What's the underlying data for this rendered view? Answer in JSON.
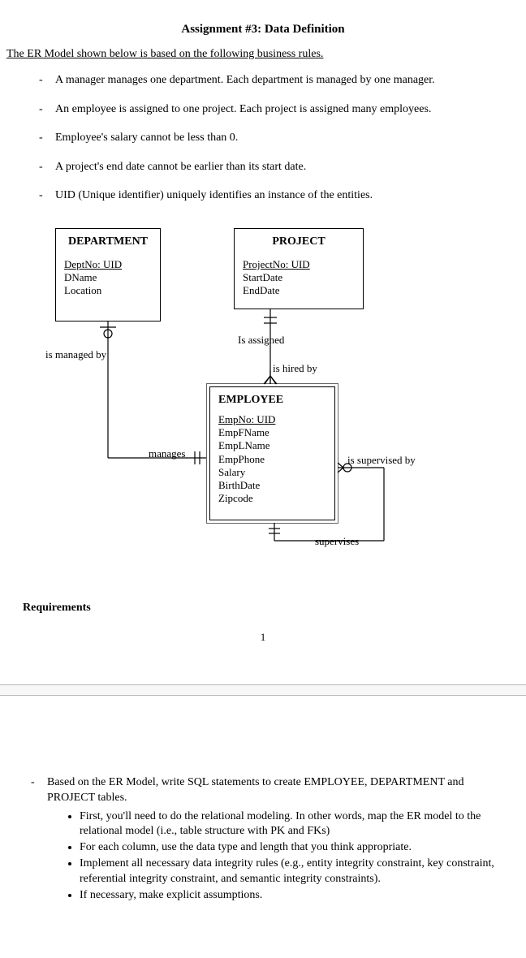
{
  "title": "Assignment #3: Data Definition",
  "intro": "The ER Model shown below is based on the following business rules.",
  "rules": [
    "A manager manages one department. Each department is managed by one manager.",
    "An employee is assigned to one project. Each project is assigned many employees.",
    "Employee's salary cannot be less than 0.",
    "A project's end date cannot be earlier than its start date.",
    "UID (Unique identifier) uniquely identifies an instance of the entities."
  ],
  "diagram": {
    "entities": {
      "department": {
        "name": "DEPARTMENT",
        "uid": "DeptNo: UID",
        "attrs": [
          "DName",
          "Location"
        ]
      },
      "project": {
        "name": "PROJECT",
        "uid": "ProjectNo: UID",
        "attrs": [
          "StartDate",
          "EndDate"
        ]
      },
      "employee": {
        "name": "EMPLOYEE",
        "uid": "EmpNo: UID",
        "attrs": [
          "EmpFName",
          "EmpLName",
          "EmpPhone",
          "Salary",
          "BirthDate",
          "Zipcode"
        ]
      }
    },
    "rels": {
      "managed_by": "is managed by",
      "manages": "manages",
      "is_assigned": "Is assigned",
      "hired_by": "is hired by",
      "supervised_by": "is supervised by",
      "supervises": "supervises"
    }
  },
  "reqheader": "Requirements",
  "pagenum": "1",
  "requirements": {
    "main": "Based on the ER Model, write SQL statements to create EMPLOYEE, DEPARTMENT and PROJECT tables.",
    "subs": [
      "First, you'll need to do the relational modeling. In other words, map the ER model to the relational model (i.e., table structure with PK and FKs)",
      "For each column, use the data type and length that you think appropriate.",
      "Implement all necessary data integrity rules (e.g., entity integrity constraint, key constraint, referential integrity constraint, and semantic integrity constraints).",
      "If necessary, make explicit assumptions."
    ]
  }
}
